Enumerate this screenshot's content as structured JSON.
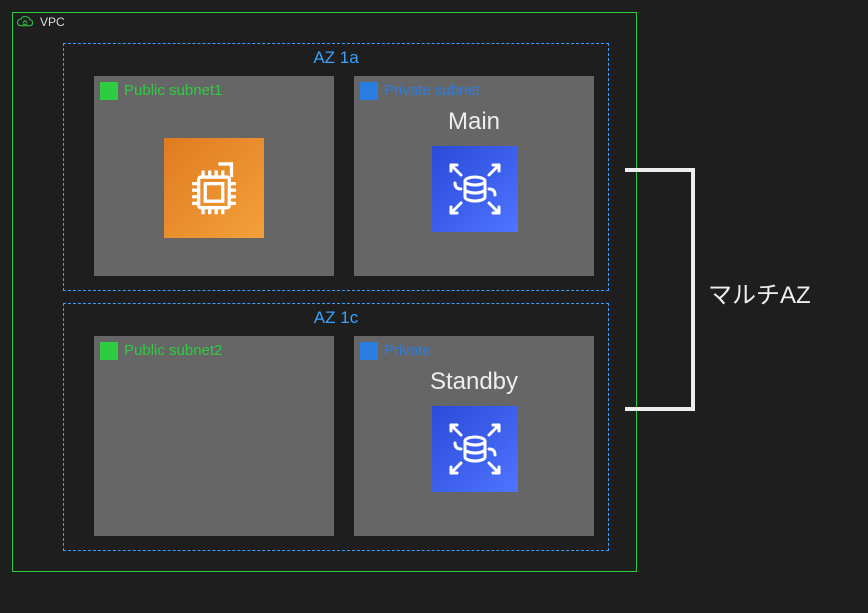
{
  "vpc": {
    "label": "VPC"
  },
  "az": {
    "a": {
      "label": "AZ 1a",
      "public": {
        "label": "Public subnet1"
      },
      "private": {
        "label": "Private subnet",
        "role": "Main"
      }
    },
    "c": {
      "label": "AZ 1c",
      "public": {
        "label": "Public subnet2"
      },
      "private": {
        "label": "Private",
        "role": "Standby"
      }
    }
  },
  "multi_az_label": "マルチAZ",
  "icons": {
    "vpc": "cloud-network-icon",
    "ec2": "ec2-icon",
    "rds": "rds-multi-az-icon",
    "public_subnet_badge": "public-subnet-badge",
    "private_subnet_badge": "private-subnet-badge"
  },
  "colors": {
    "vpc_border": "#2ecc40",
    "az_border": "#3aa0ff",
    "subnet_bg": "#666666",
    "ec2_bg": "#f3a03c",
    "rds_bg": "#4f74ff",
    "connector": "#eeeeee"
  }
}
